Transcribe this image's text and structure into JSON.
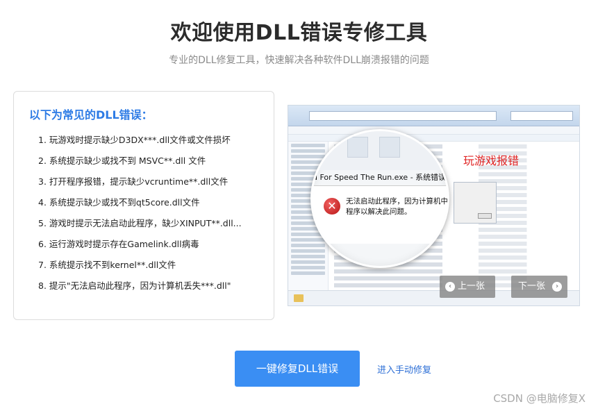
{
  "header": {
    "title": "欢迎使用DLL错误专修工具",
    "subtitle": "专业的DLL修复工具，快速解决各种软件DLL崩溃报错的问题"
  },
  "errors_card": {
    "heading": "以下为常见的DLL错误：",
    "items": [
      "1. 玩游戏时提示缺少D3DX***.dll文件或文件损坏",
      "2. 系统提示缺少或找不到 MSVC**.dll 文件",
      "3. 打开程序报错，提示缺少vcruntime**.dll文件",
      "4. 系统提示缺少或找不到qt5core.dll文件",
      "5. 游戏时提示无法启动此程序，缺少XINPUT**.dll...",
      "6. 运行游戏时提示存在Gamelink.dll病毒",
      "7. 系统提示找不到kernel**.dll文件",
      "8. 提示\"无法启动此程序，因为计算机丢失***.dll\""
    ]
  },
  "slider": {
    "caption": "玩游戏报错",
    "zoom_title": "d For Speed The Run.exe - 系统错误",
    "zoom_message_line1": "无法启动此程序，因为计算机中",
    "zoom_message_line2": "程序以解决此问题。",
    "prev_label": "上一张",
    "next_label": "下一张"
  },
  "actions": {
    "primary_label": "一键修复DLL错误",
    "manual_label": "进入手动修复"
  },
  "watermark": "CSDN @电脑修复X",
  "colors": {
    "accent": "#3a8ef3",
    "heading_blue": "#2d7be5",
    "error_red": "#e02424"
  }
}
